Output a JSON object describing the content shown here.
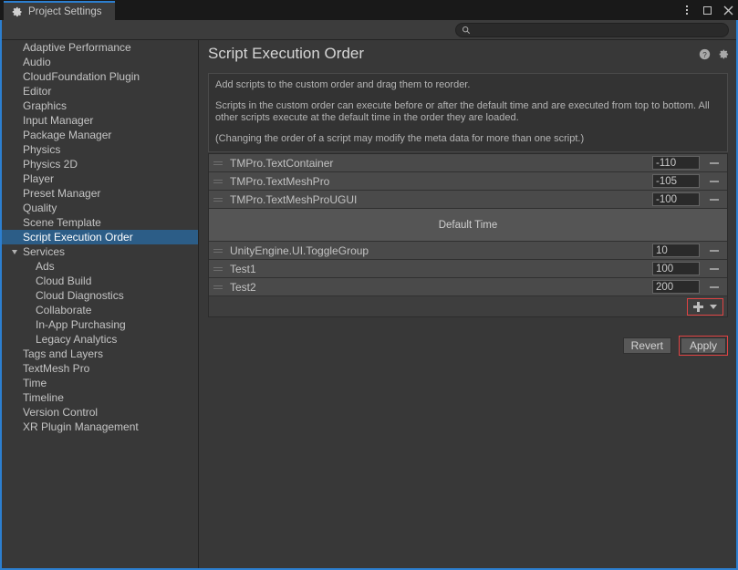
{
  "window": {
    "tab_title": "Project Settings",
    "tab_icon": "gear-icon",
    "controls": {
      "menu": "kebab-menu-icon",
      "maximize": "maximize-icon",
      "close": "close-icon"
    }
  },
  "search": {
    "value": "",
    "placeholder": "",
    "icon": "search-icon"
  },
  "sidebar": {
    "items": [
      {
        "label": "Adaptive Performance",
        "level": 0,
        "selected": false
      },
      {
        "label": "Audio",
        "level": 0,
        "selected": false
      },
      {
        "label": "CloudFoundation Plugin",
        "level": 0,
        "selected": false
      },
      {
        "label": "Editor",
        "level": 0,
        "selected": false
      },
      {
        "label": "Graphics",
        "level": 0,
        "selected": false
      },
      {
        "label": "Input Manager",
        "level": 0,
        "selected": false
      },
      {
        "label": "Package Manager",
        "level": 0,
        "selected": false
      },
      {
        "label": "Physics",
        "level": 0,
        "selected": false
      },
      {
        "label": "Physics 2D",
        "level": 0,
        "selected": false
      },
      {
        "label": "Player",
        "level": 0,
        "selected": false
      },
      {
        "label": "Preset Manager",
        "level": 0,
        "selected": false
      },
      {
        "label": "Quality",
        "level": 0,
        "selected": false
      },
      {
        "label": "Scene Template",
        "level": 0,
        "selected": false
      },
      {
        "label": "Script Execution Order",
        "level": 0,
        "selected": true
      },
      {
        "label": "Services",
        "level": 0,
        "selected": false,
        "expanded": true
      },
      {
        "label": "Ads",
        "level": 1,
        "selected": false
      },
      {
        "label": "Cloud Build",
        "level": 1,
        "selected": false
      },
      {
        "label": "Cloud Diagnostics",
        "level": 1,
        "selected": false
      },
      {
        "label": "Collaborate",
        "level": 1,
        "selected": false
      },
      {
        "label": "In-App Purchasing",
        "level": 1,
        "selected": false
      },
      {
        "label": "Legacy Analytics",
        "level": 1,
        "selected": false
      },
      {
        "label": "Tags and Layers",
        "level": 0,
        "selected": false
      },
      {
        "label": "TextMesh Pro",
        "level": 0,
        "selected": false
      },
      {
        "label": "Time",
        "level": 0,
        "selected": false
      },
      {
        "label": "Timeline",
        "level": 0,
        "selected": false
      },
      {
        "label": "Version Control",
        "level": 0,
        "selected": false
      },
      {
        "label": "XR Plugin Management",
        "level": 0,
        "selected": false
      }
    ]
  },
  "main": {
    "title": "Script Execution Order",
    "header_icons": {
      "help": "help-icon",
      "settings": "gear-icon"
    },
    "help_text": [
      "Add scripts to the custom order and drag them to reorder.",
      "Scripts in the custom order can execute before or after the default time and are executed from top to bottom. All other scripts execute at the default time in the order they are loaded.",
      "(Changing the order of a script may modify the meta data for more than one script.)"
    ],
    "default_time_label": "Default Time",
    "rows_before_default": [
      {
        "name": "TMPro.TextContainer",
        "order": "-110"
      },
      {
        "name": "TMPro.TextMeshPro",
        "order": "-105"
      },
      {
        "name": "TMPro.TextMeshProUGUI",
        "order": "-100"
      }
    ],
    "rows_after_default": [
      {
        "name": "UnityEngine.UI.ToggleGroup",
        "order": "10"
      },
      {
        "name": "Test1",
        "order": "100"
      },
      {
        "name": "Test2",
        "order": "200"
      }
    ],
    "add_button": {
      "icon": "plus-icon",
      "dropdown_icon": "chevron-down-icon",
      "highlighted": true
    },
    "buttons": {
      "revert": "Revert",
      "apply": "Apply",
      "apply_highlighted": true
    }
  },
  "colors": {
    "background": "#383838",
    "panel": "#3c3c3c",
    "titlebar": "#191919",
    "row": "#4a4a4a",
    "default_band": "#555555",
    "selection_blue": "#2c5d87",
    "focus_blue": "#2c7fd0",
    "annotation_red": "#e04343",
    "text": "#c4c4c4"
  }
}
